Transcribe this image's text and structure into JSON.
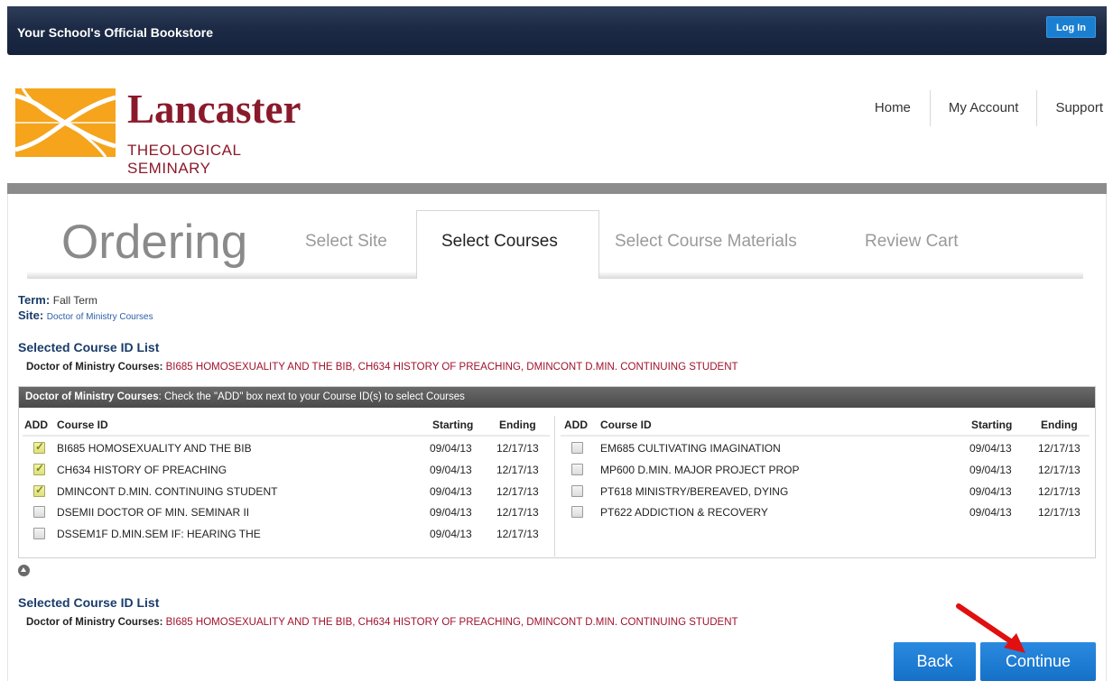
{
  "topbar": {
    "title": "Your School's Official Bookstore",
    "login": "Log In"
  },
  "logo": {
    "name": "Lancaster",
    "subtitle": "THEOLOGICAL SEMINARY"
  },
  "nav": [
    "Home",
    "My Account",
    "Support"
  ],
  "ordering": {
    "heading": "Ordering",
    "tabs": [
      "Select Site",
      "Select Courses",
      "Select Course Materials",
      "Review Cart"
    ],
    "active_tab": "Select Courses"
  },
  "info": {
    "term_label": "Term:",
    "term_value": "Fall Term",
    "site_label": "Site:",
    "site_value": "Doctor of Ministry Courses"
  },
  "selected_list": {
    "title": "Selected Course ID List",
    "label": "Doctor of Ministry Courses:",
    "value": "BI685 HOMOSEXUALITY AND THE BIB, CH634 HISTORY OF PREACHING, DMINCONT D.MIN. CONTINUING STUDENT"
  },
  "courses": {
    "bar_bold": "Doctor of Ministry Courses",
    "bar_text": ": Check the \"ADD\" box next to your Course ID(s) to select Courses",
    "headers": {
      "add": "ADD",
      "course": "Course ID",
      "start": "Starting",
      "end": "Ending"
    },
    "left": [
      {
        "id": "BI685 HOMOSEXUALITY AND THE BIB",
        "start": "09/04/13",
        "end": "12/17/13",
        "checked": true
      },
      {
        "id": "CH634 HISTORY OF PREACHING",
        "start": "09/04/13",
        "end": "12/17/13",
        "checked": true
      },
      {
        "id": "DMINCONT D.MIN. CONTINUING STUDENT",
        "start": "09/04/13",
        "end": "12/17/13",
        "checked": true
      },
      {
        "id": "DSEMII DOCTOR OF MIN. SEMINAR II",
        "start": "09/04/13",
        "end": "12/17/13",
        "checked": false
      },
      {
        "id": "DSSEM1F D.MIN.SEM IF: HEARING THE",
        "start": "09/04/13",
        "end": "12/17/13",
        "checked": false
      }
    ],
    "right": [
      {
        "id": "EM685 CULTIVATING IMAGINATION",
        "start": "09/04/13",
        "end": "12/17/13",
        "checked": false
      },
      {
        "id": "MP600 D.MIN. MAJOR PROJECT PROP",
        "start": "09/04/13",
        "end": "12/17/13",
        "checked": false
      },
      {
        "id": "PT618 MINISTRY/BEREAVED, DYING",
        "start": "09/04/13",
        "end": "12/17/13",
        "checked": false
      },
      {
        "id": "PT622 ADDICTION & RECOVERY",
        "start": "09/04/13",
        "end": "12/17/13",
        "checked": false
      }
    ]
  },
  "buttons": {
    "back": "Back",
    "continue": "Continue"
  },
  "colors": {
    "accent": "#1a7fd1",
    "brand": "#8a1a2b",
    "topbar": "#1c2a45",
    "selected_text": "#a0122d"
  }
}
